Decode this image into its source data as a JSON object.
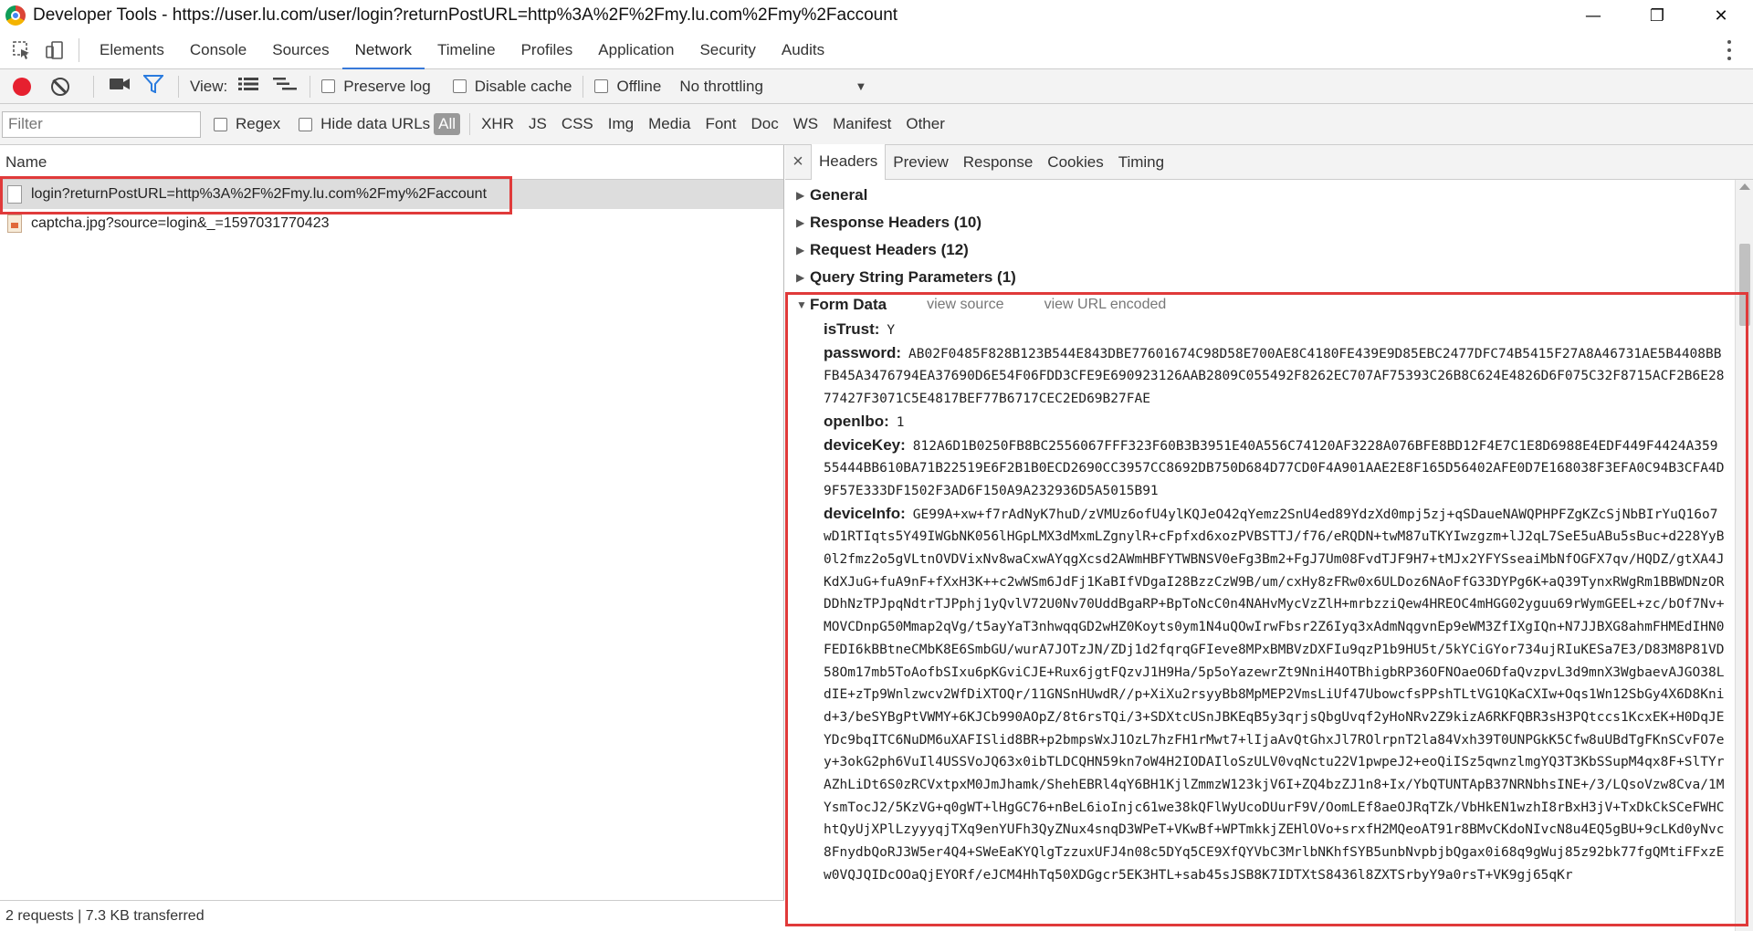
{
  "window": {
    "title": "Developer Tools - https://user.lu.com/user/login?returnPostURL=http%3A%2F%2Fmy.lu.com%2Fmy%2Faccount",
    "minimize": "—",
    "restore": "❐",
    "close": "✕"
  },
  "devtools_tabs": [
    "Elements",
    "Console",
    "Sources",
    "Network",
    "Timeline",
    "Profiles",
    "Application",
    "Security",
    "Audits"
  ],
  "active_tab": "Network",
  "toolbar": {
    "view_label": "View:",
    "preserve_log": "Preserve log",
    "disable_cache": "Disable cache",
    "offline": "Offline",
    "throttling": "No throttling"
  },
  "filterbar": {
    "placeholder": "Filter",
    "regex": "Regex",
    "hide_data_urls": "Hide data URLs",
    "all": "All",
    "types": [
      "XHR",
      "JS",
      "CSS",
      "Img",
      "Media",
      "Font",
      "Doc",
      "WS",
      "Manifest",
      "Other"
    ]
  },
  "requests": {
    "header": "Name",
    "rows": [
      "login?returnPostURL=http%3A%2F%2Fmy.lu.com%2Fmy%2Faccount",
      "captcha.jpg?source=login&_=1597031770423"
    ],
    "status": "2 requests | 7.3 KB transferred"
  },
  "details": {
    "close": "×",
    "tabs": [
      "Headers",
      "Preview",
      "Response",
      "Cookies",
      "Timing"
    ],
    "sections": {
      "general": "General",
      "response_headers": "Response Headers (10)",
      "request_headers": "Request Headers (12)",
      "query_string": "Query String Parameters (1)",
      "form_data": "Form Data"
    },
    "view_source": "view source",
    "view_url_encoded": "view URL encoded",
    "form": {
      "isTrust_key": "isTrust:",
      "isTrust": "Y",
      "password_key": "password:",
      "password": "AB02F0485F828B123B544E843DBE77601674C98D58E700AE8C4180FE439E9D85EBC2477DFC74B5415F27A8A46731AE5B4408BBFB45A3476794EA37690D6E54F06FDD3CFE9E690923126AAB2809C055492F8262EC707AF75393C26B8C624E4826D6F075C32F8715ACF2B6E2877427F3071C5E4817BEF77B6717CEC2ED69B27FAE",
      "openlbo_key": "openlbo:",
      "openlbo": "1",
      "deviceKey_key": "deviceKey:",
      "deviceKey": "812A6D1B0250FB8BC2556067FFF323F60B3B3951E40A556C74120AF3228A076BFE8BD12F4E7C1E8D6988E4EDF449F4424A35955444BB610BA71B22519E6F2B1B0ECD2690CC3957CC8692DB750D684D77CD0F4A901AAE2E8F165D56402AFE0D7E168038F3EFA0C94B3CFA4D9F57E333DF1502F3AD6F150A9A232936D5A5015B91",
      "deviceInfo_key": "deviceInfo:",
      "deviceInfo": "GE99A+xw+f7rAdNyK7huD/zVMUz6ofU4ylKQJeO42qYemz2SnU4ed89YdzXd0mpj5zj+qSDaueNAWQPHPFZgKZcSjNbBIrYuQ16o7wD1RTIqts5Y49IWGbNK056lHGpLMX3dMxmLZgnylR+cFpfxd6xozPVBSTTJ/f76/eRQDN+twM87uTKYIwzgzm+lJ2qL7SeE5uABu5sBuc+d228YyB0l2fmz2o5gVLtnOVDVixNv8waCxwAYqgXcsd2AWmHBFYTWBNSV0eFg3Bm2+FgJ7Um08FvdTJF9H7+tMJx2YFYSseaiMbNfOGFX7qv/HQDZ/gtXA4JKdXJuG+fuA9nF+fXxH3K++c2wWSm6JdFj1KaBIfVDgaI28BzzCzW9B/um/cxHy8zFRw0x6ULDoz6NAoFfG33DYPg6K+aQ39TynxRWgRm1BBWDNzORDDhNzTPJpqNdtrTJPphj1yQvlV72U0Nv70UddBgaRP+BpToNcC0n4NAHvMycVzZlH+mrbzziQew4HREOC4mHGG02yguu69rWymGEEL+zc/bOf7Nv+MOVCDnpG50Mmap2qVg/t5ayYaT3nhwqqGD2wHZ0Koyts0ym1N4uQOwIrwFbsr2Z6Iyq3xAdmNqgvnEp9eWM3ZfIXgIQn+N7JJBXG8ahmFHMEdIHN0FEDI6kBBtneCMbK8E6SmbGU/wurA7JOTzJN/ZDj1d2fqrqGFIeve8MPxBMBVzDXFIu9qzP1b9HU5t/5kYCiGYor734ujRIuKESa7E3/D83M8P81VD58Om17mb5ToAofbSIxu6pKGviCJE+Rux6jgtFQzvJ1H9Ha/5p5oYazewrZt9NniH4OTBhigbRP36OFNOaeO6DfaQvzpvL3d9mnX3WgbaevAJGO38LdIE+zTp9Wnlzwcv2WfDiXTOQr/11GNSnHUwdR//p+XiXu2rsyyBb8MpMEP2VmsLiUf47UbowcfsPPshTLtVG1QKaCXIw+Oqs1Wn12SbGy4X6D8Knid+3/beSYBgPtVWMY+6KJCb990AOpZ/8t6rsTQi/3+SDXtcUSnJBKEqB5y3qrjsQbgUvqf2yHoNRv2Z9kizA6RKFQBR3sH3PQtccs1KcxEK+H0DqJEYDc9bqITC6NuDM6uXAFISlid8BR+p2bmpsWxJ1OzL7hzFH1rMwt7+lIjaAvQtGhxJl7ROlrpnT2la84Vxh39T0UNPGkK5Cfw8uUBdTgFKnSCvFO7ey+3okG2ph6VuIl4USSVoJQ63x0ibTLDCQHN59kn7oW4H2IODAIloSzULV0vqNctu22V1pwpeJ2+eoQiISz5qwnzlmgYQ3T3KbSSupM4qx8F+SlTYrAZhLiDt6S0zRCVxtpxM0JmJhamk/ShehEBRl4qY6BH1KjlZmmzW123kjV6I+ZQ4bzZJ1n8+Ix/YbQTUNTApB37NRNbhsINE+/3/LQsoVzw8Cva/1MYsmTocJ2/5KzVG+q0gWT+lHgGC76+nBeL6ioInjc61we38kQFlWyUcoDUurF9V/OomLEf8aeOJRqTZk/VbHkEN1wzhI8rBxH3jV+TxDkCkSCeFWHChtQyUjXPlLzyyyqjTXq9enYUFh3QyZNux4snqD3WPeT+VKwBf+WPTmkkjZEHlOVo+srxfH2MQeoAT91r8BMvCKdoNIvcN8u4EQ5gBU+9cLKd0yNvc8FnydbQoRJ3W5er4Q4+SWeEaKYQlgTzzuxUFJ4n08c5DYq5CE9XfQYVbC3MrlbNKhfSYB5unbNvpbjbQgax0i68q9gWuj85z92bk77fgQMtiFFxzEw0VQJQIDcOOaQjEYORf/eJCM4HhTq50XDGgcr5EK3HTL+sab45sJSB8K7IDTXtS8436l8ZXTSrbyY9a0rsT+VK9gj65qKr"
    }
  }
}
